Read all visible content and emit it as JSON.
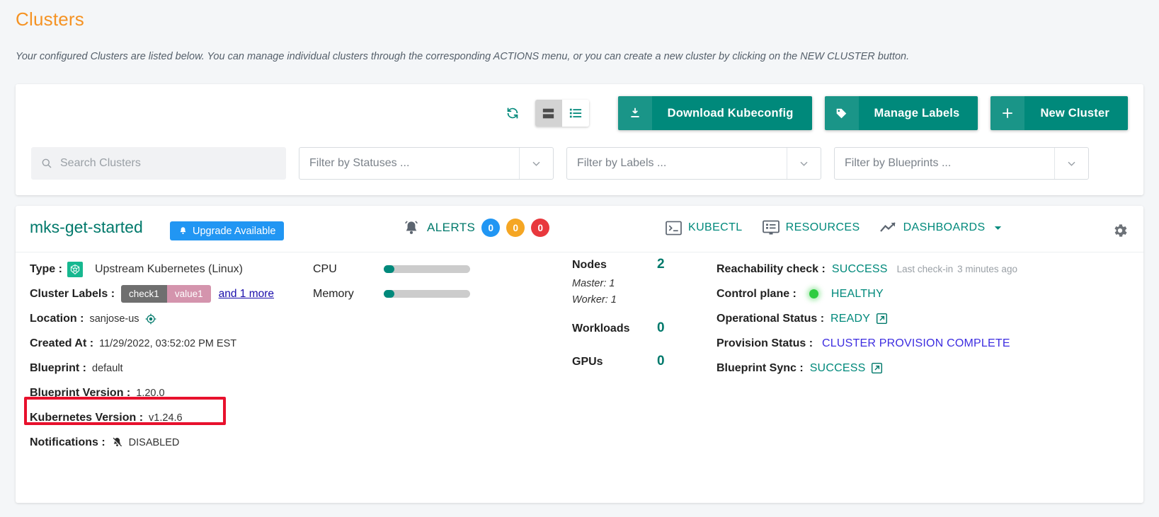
{
  "header": {
    "title": "Clusters",
    "subtitle": "Your configured Clusters are listed below. You can manage individual clusters through the corresponding ACTIONS menu, or you can create a new cluster by clicking on the NEW CLUSTER button."
  },
  "toolbar": {
    "refresh_icon": "refresh-icon",
    "card_view_icon": "card-view-icon",
    "list_view_icon": "list-view-icon",
    "buttons": [
      {
        "label": "Download Kubeconfig",
        "icon": "download-icon"
      },
      {
        "label": "Manage Labels",
        "icon": "tag-icon"
      },
      {
        "label": "New Cluster",
        "icon": "plus-icon"
      }
    ],
    "accent_color": "#00897b"
  },
  "filters": {
    "search_placeholder": "Search Clusters",
    "search_value": "",
    "statuses_placeholder": "Filter by Statuses ...",
    "labels_placeholder": "Filter by Labels ...",
    "blueprints_placeholder": "Filter by Blueprints ..."
  },
  "cluster": {
    "name": "mks-get-started",
    "upgrade_badge": "Upgrade Available",
    "alerts": {
      "label": "ALERTS",
      "badges": [
        {
          "count": "0",
          "color": "#2196f3"
        },
        {
          "count": "0",
          "color": "#f5a623"
        },
        {
          "count": "0",
          "color": "#e8383d"
        }
      ]
    },
    "actions": [
      {
        "label": "KUBECTL",
        "icon": "terminal-icon"
      },
      {
        "label": "RESOURCES",
        "icon": "resources-icon"
      },
      {
        "label": "DASHBOARDS",
        "icon": "trending-up-icon"
      }
    ],
    "settings_icon": "gear-icon",
    "info": {
      "type_key": "Type :",
      "type_value": "Upstream Kubernetes (Linux)",
      "labels_key": "Cluster Labels :",
      "label_chip_key": "check1",
      "label_chip_value": "value1",
      "labels_more": "and 1 more",
      "location_key": "Location :",
      "location_value": "sanjose-us",
      "created_key": "Created At :",
      "created_value": "11/29/2022, 03:52:02 PM EST",
      "blueprint_key": "Blueprint :",
      "blueprint_value": "default",
      "blueprint_version_key": "Blueprint Version :",
      "blueprint_version_value": "1.20.0",
      "k8s_version_key": "Kubernetes Version :",
      "k8s_version_value": "v1.24.6",
      "notifications_key": "Notifications :",
      "notifications_value": "DISABLED",
      "highlight_color": "#e8112d"
    },
    "gauges": {
      "cpu_label": "CPU",
      "cpu_percent": 12,
      "memory_label": "Memory",
      "memory_percent": 12
    },
    "counts": {
      "nodes_label": "Nodes",
      "nodes_value": "2",
      "master_sub": "Master: 1",
      "worker_sub": "Worker: 1",
      "workloads_label": "Workloads",
      "workloads_value": "0",
      "gpus_label": "GPUs",
      "gpus_value": "0"
    },
    "status": {
      "reachability_key": "Reachability check :",
      "reachability_value": "SUCCESS",
      "reachability_note_label": "Last check-in",
      "reachability_note_value": "3 minutes ago",
      "control_plane_key": "Control plane :",
      "control_plane_value": "HEALTHY",
      "operational_key": "Operational Status :",
      "operational_value": "READY",
      "provision_key": "Provision Status :",
      "provision_value": "CLUSTER PROVISION COMPLETE",
      "blueprint_sync_key": "Blueprint Sync :",
      "blueprint_sync_value": "SUCCESS"
    }
  }
}
